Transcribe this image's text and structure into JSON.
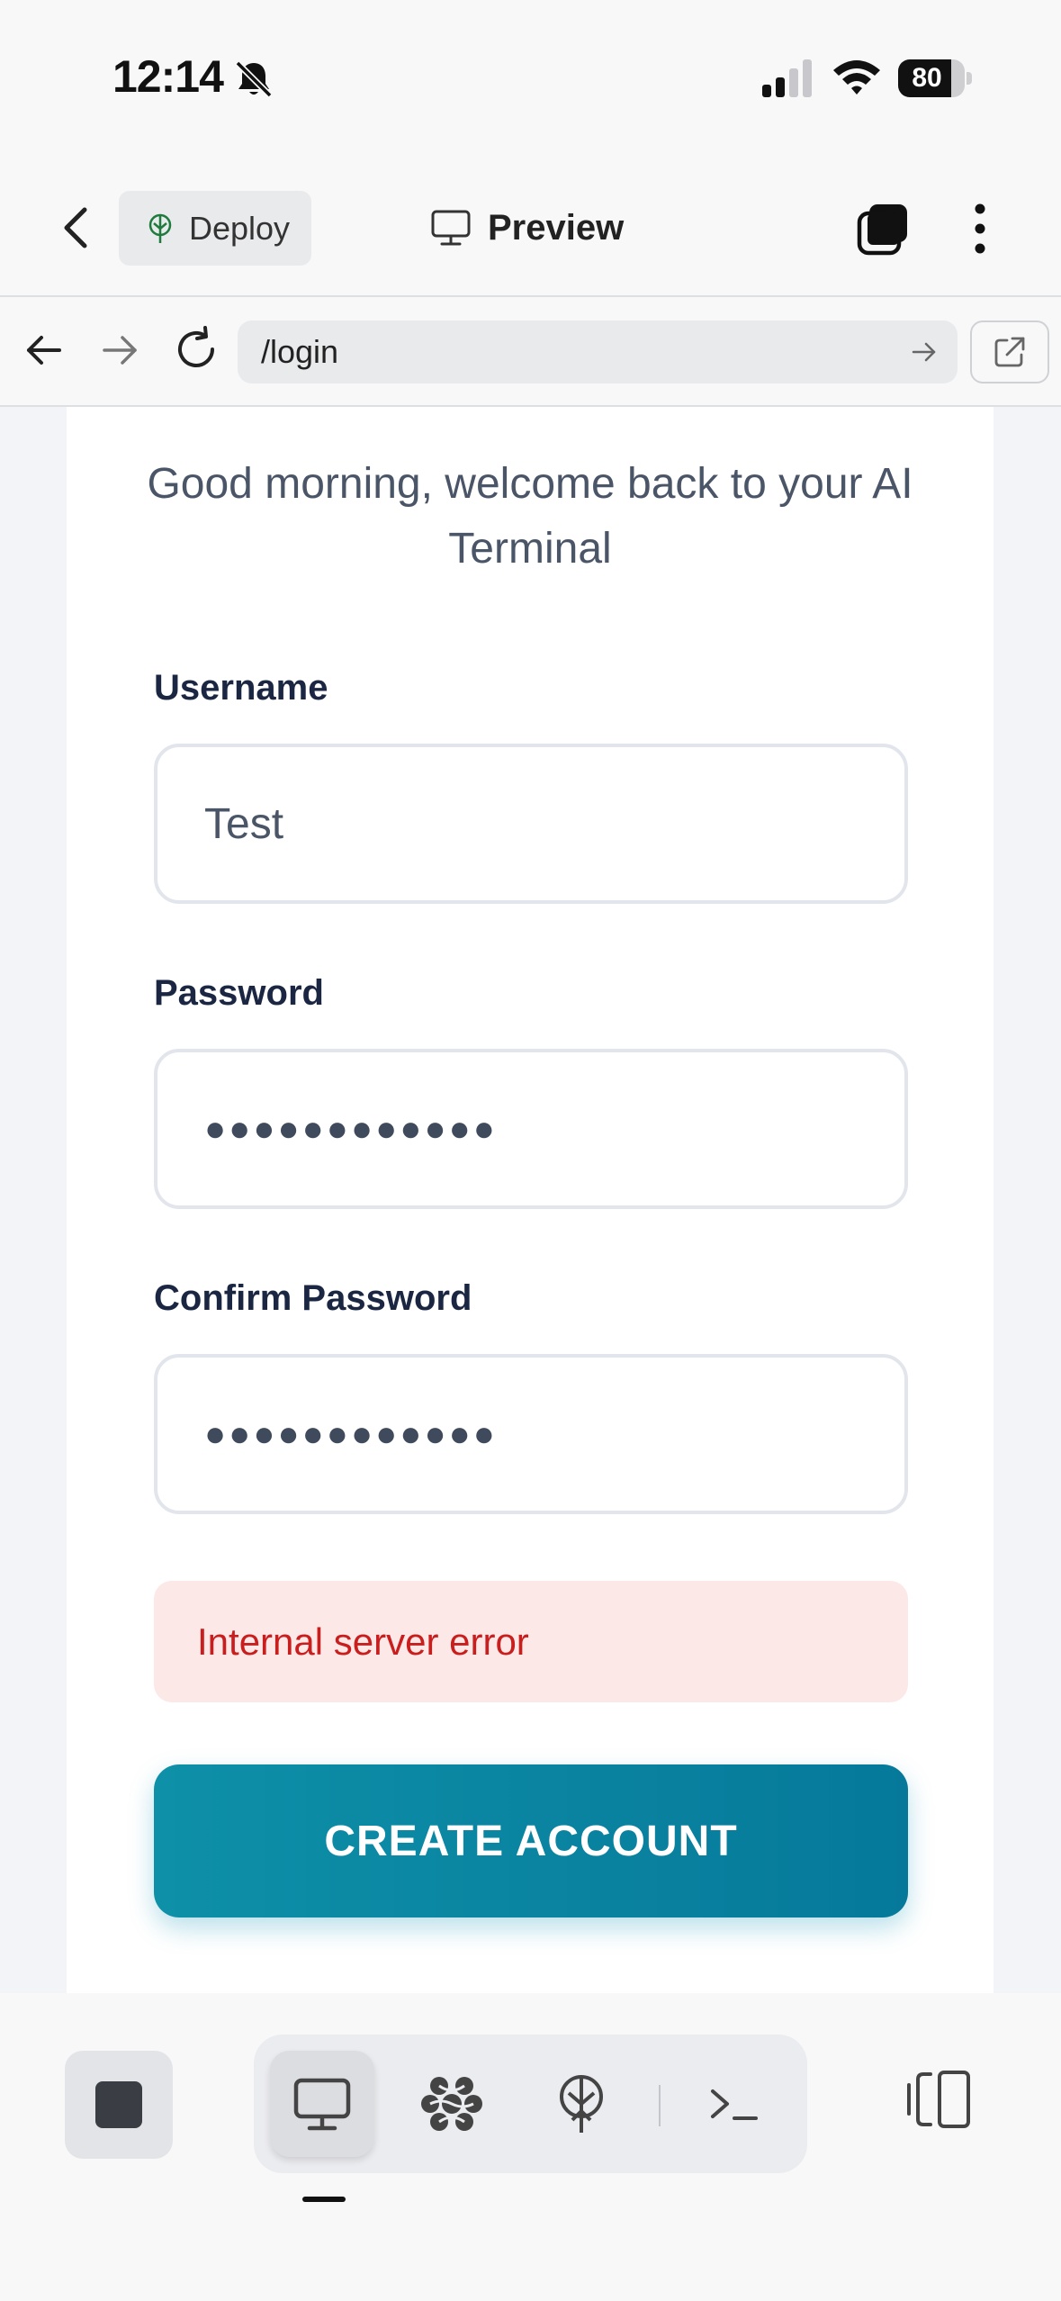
{
  "status_bar": {
    "time": "12:14",
    "battery": "80",
    "battery_level": 0.8,
    "icons": [
      "bell-slash-icon",
      "signal-icon",
      "wifi-icon",
      "battery-icon"
    ]
  },
  "header": {
    "deploy_label": "Deploy",
    "title": "Preview",
    "icons": [
      "chevron-left-icon",
      "deploy-tree-icon",
      "monitor-icon",
      "tabs-icon",
      "more-vertical-icon"
    ]
  },
  "url_bar": {
    "url": "/login",
    "icons": [
      "arrow-left-icon",
      "arrow-right-icon",
      "reload-icon",
      "go-arrow-icon",
      "external-link-icon"
    ]
  },
  "form": {
    "welcome": "Good morning, welcome back to your AI Terminal",
    "username_label": "Username",
    "username_value": "Test",
    "password_label": "Password",
    "password_value": "●●●●●●●●●●●●",
    "confirm_label": "Confirm Password",
    "confirm_value": "●●●●●●●●●●●●",
    "error": "Internal server error",
    "submit_label": "CREATE ACCOUNT"
  },
  "toolbar": {
    "active_tool": "preview",
    "tools": [
      "stop-icon",
      "monitor-icon",
      "ai-icon",
      "deploy-icon",
      "terminal-icon",
      "panel-icon"
    ]
  },
  "colors": {
    "accent": "#0891b2",
    "error_bg": "#fde8e8",
    "error_text": "#c81e1e"
  }
}
